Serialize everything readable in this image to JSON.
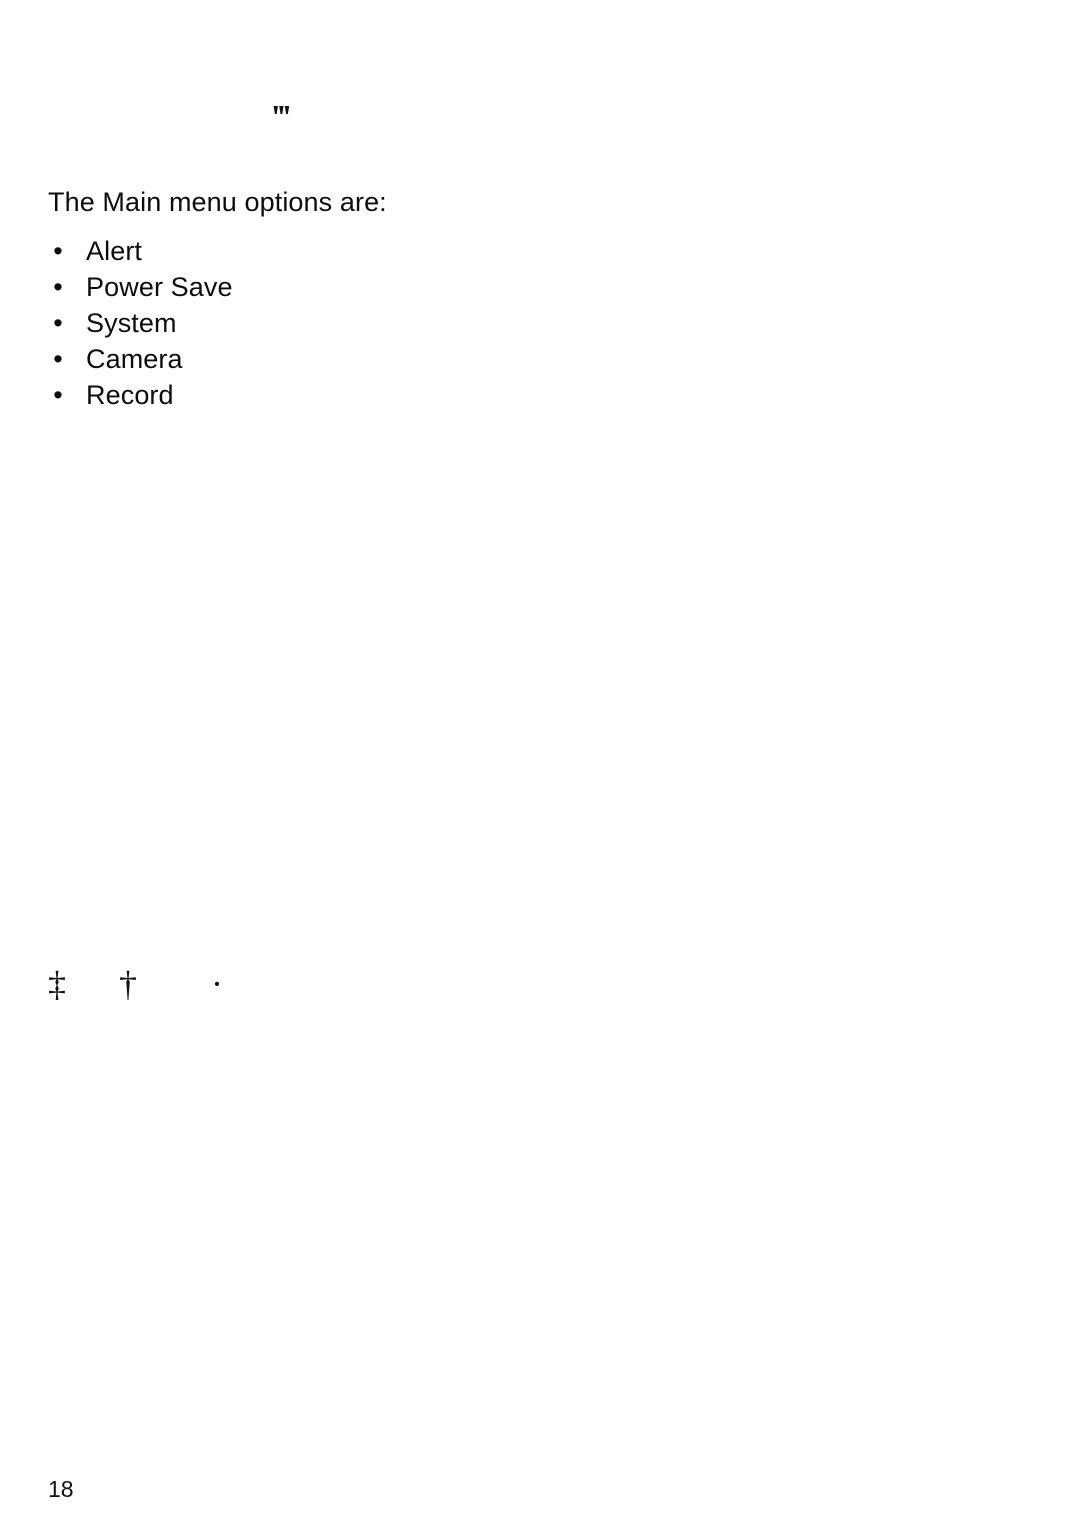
{
  "document": {
    "page_number": "18",
    "background_color": "#ffffff",
    "text_color": "#0d0d0d"
  },
  "artifacts": {
    "top_prime": "‴",
    "dagger_double": "‡",
    "dagger_single": "†",
    "middle_dot": "·"
  },
  "body": {
    "lead_paragraph": "The Main menu options are:",
    "bullet_glyph": "•",
    "menu_options": [
      {
        "label": "Alert"
      },
      {
        "label": "Power Save"
      },
      {
        "label": "System"
      },
      {
        "label": "Camera"
      },
      {
        "label": "Record"
      }
    ]
  }
}
